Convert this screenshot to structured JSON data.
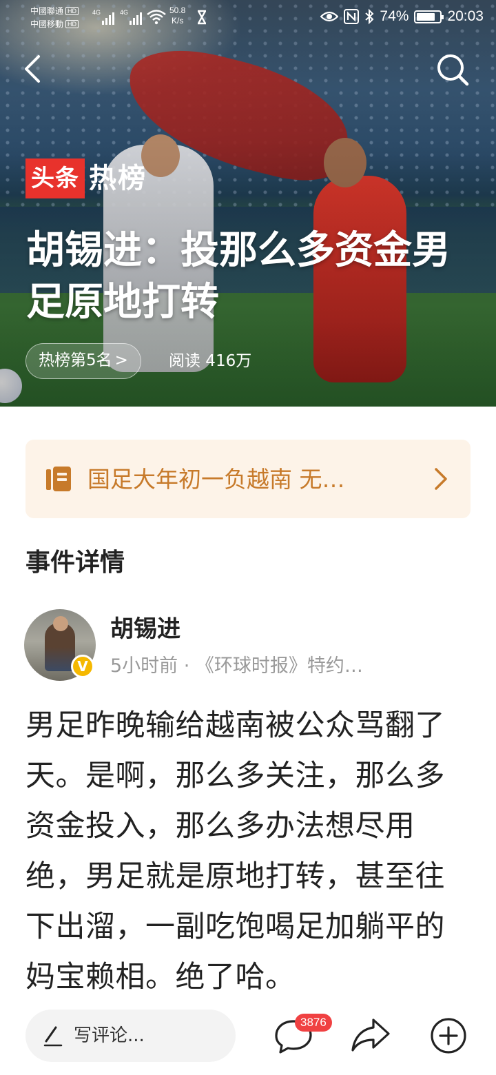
{
  "status_bar": {
    "carrier_1": "中國聯通",
    "carrier_2": "中國移動",
    "hd_label": "HD",
    "network_1": "4G",
    "network_2": "4G",
    "speed_value": "50.8",
    "speed_unit": "K/s",
    "battery": "74%",
    "time": "20:03"
  },
  "header": {
    "brand_red": "头条",
    "brand_text": "热榜",
    "title": "胡锡进：投那么多资金男足原地打转",
    "rank": "热榜第5名",
    "reads": "阅读 416万"
  },
  "topic": {
    "text": "国足大年初一负越南 无…"
  },
  "section": {
    "heading": "事件详情"
  },
  "author": {
    "name": "胡锡进",
    "badge": "V",
    "meta": "5小时前 · 《环球时报》特约…"
  },
  "article": {
    "body": "男足昨晚输给越南被公众骂翻了天。是啊，那么多关注，那么多资金投入，那么多办法想尽用绝，男足就是原地打转，甚至往下出溜，一副吃饱喝足加躺平的妈宝赖相。绝了哈。"
  },
  "bottom_bar": {
    "comment_placeholder": "写评论...",
    "comment_count": "3876"
  },
  "colors": {
    "brand_red": "#e8322c",
    "topic_bg": "#fdf3e8",
    "topic_text": "#c77a2a",
    "badge_red": "#f04142",
    "verified_gold": "#f5b800"
  },
  "icons": [
    "back-arrow-icon",
    "search-icon",
    "book-icon",
    "chevron-right-icon",
    "pen-icon",
    "comment-icon",
    "share-icon",
    "plus-circle-icon"
  ]
}
